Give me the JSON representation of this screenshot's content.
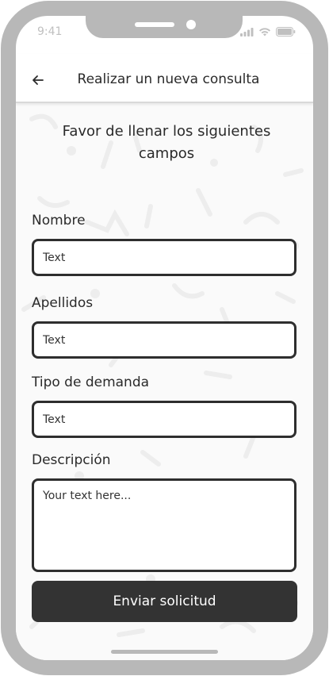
{
  "status_bar": {
    "time": "9:41"
  },
  "header": {
    "back_icon": "arrow-left-icon",
    "title": "Realizar un nueva consulta"
  },
  "form": {
    "heading": "Favor de llenar los siguientes campos",
    "fields": [
      {
        "label": "Nombre",
        "placeholder": "Text"
      },
      {
        "label": "Apellidos",
        "placeholder": "Text"
      },
      {
        "label": "Tipo de demanda",
        "placeholder": "Text"
      },
      {
        "label": "Descripción",
        "placeholder": "Your text here..."
      }
    ],
    "submit_label": "Enviar solicitud"
  },
  "colors": {
    "bezel": "#b8b8b8",
    "button": "#333333",
    "border": "#2e2e2e",
    "background": "#fafafa"
  }
}
